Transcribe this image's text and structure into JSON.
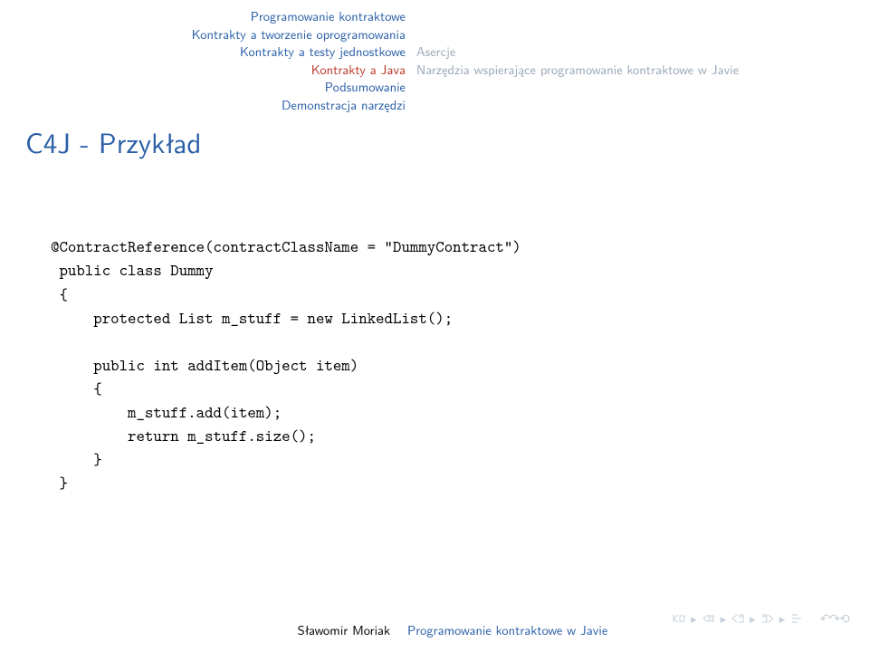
{
  "nav_left": {
    "items": [
      "Programowanie kontraktowe",
      "Kontrakty a tworzenie oprogramowania",
      "Kontrakty a testy jednostkowe",
      "Kontrakty a Java",
      "Podsumowanie",
      "Demonstracja narzędzi"
    ],
    "current_index": 3
  },
  "nav_right": {
    "items": [
      "Asercje",
      "Narzędzia wspierające programowanie kontraktowe w Javie"
    ],
    "current_index": -1
  },
  "slide_title": "C4J - Przykład",
  "code": "@ContractReference(contractClassName = \"DummyContract\")\n public class Dummy\n {\n     protected List m_stuff = new LinkedList();\n\n     public int addItem(Object item)\n     {\n         m_stuff.add(item);\n         return m_stuff.size();\n     }\n }",
  "footer": {
    "author": "Sławomir Moriak",
    "title": "Programowanie kontraktowe w Javie"
  }
}
